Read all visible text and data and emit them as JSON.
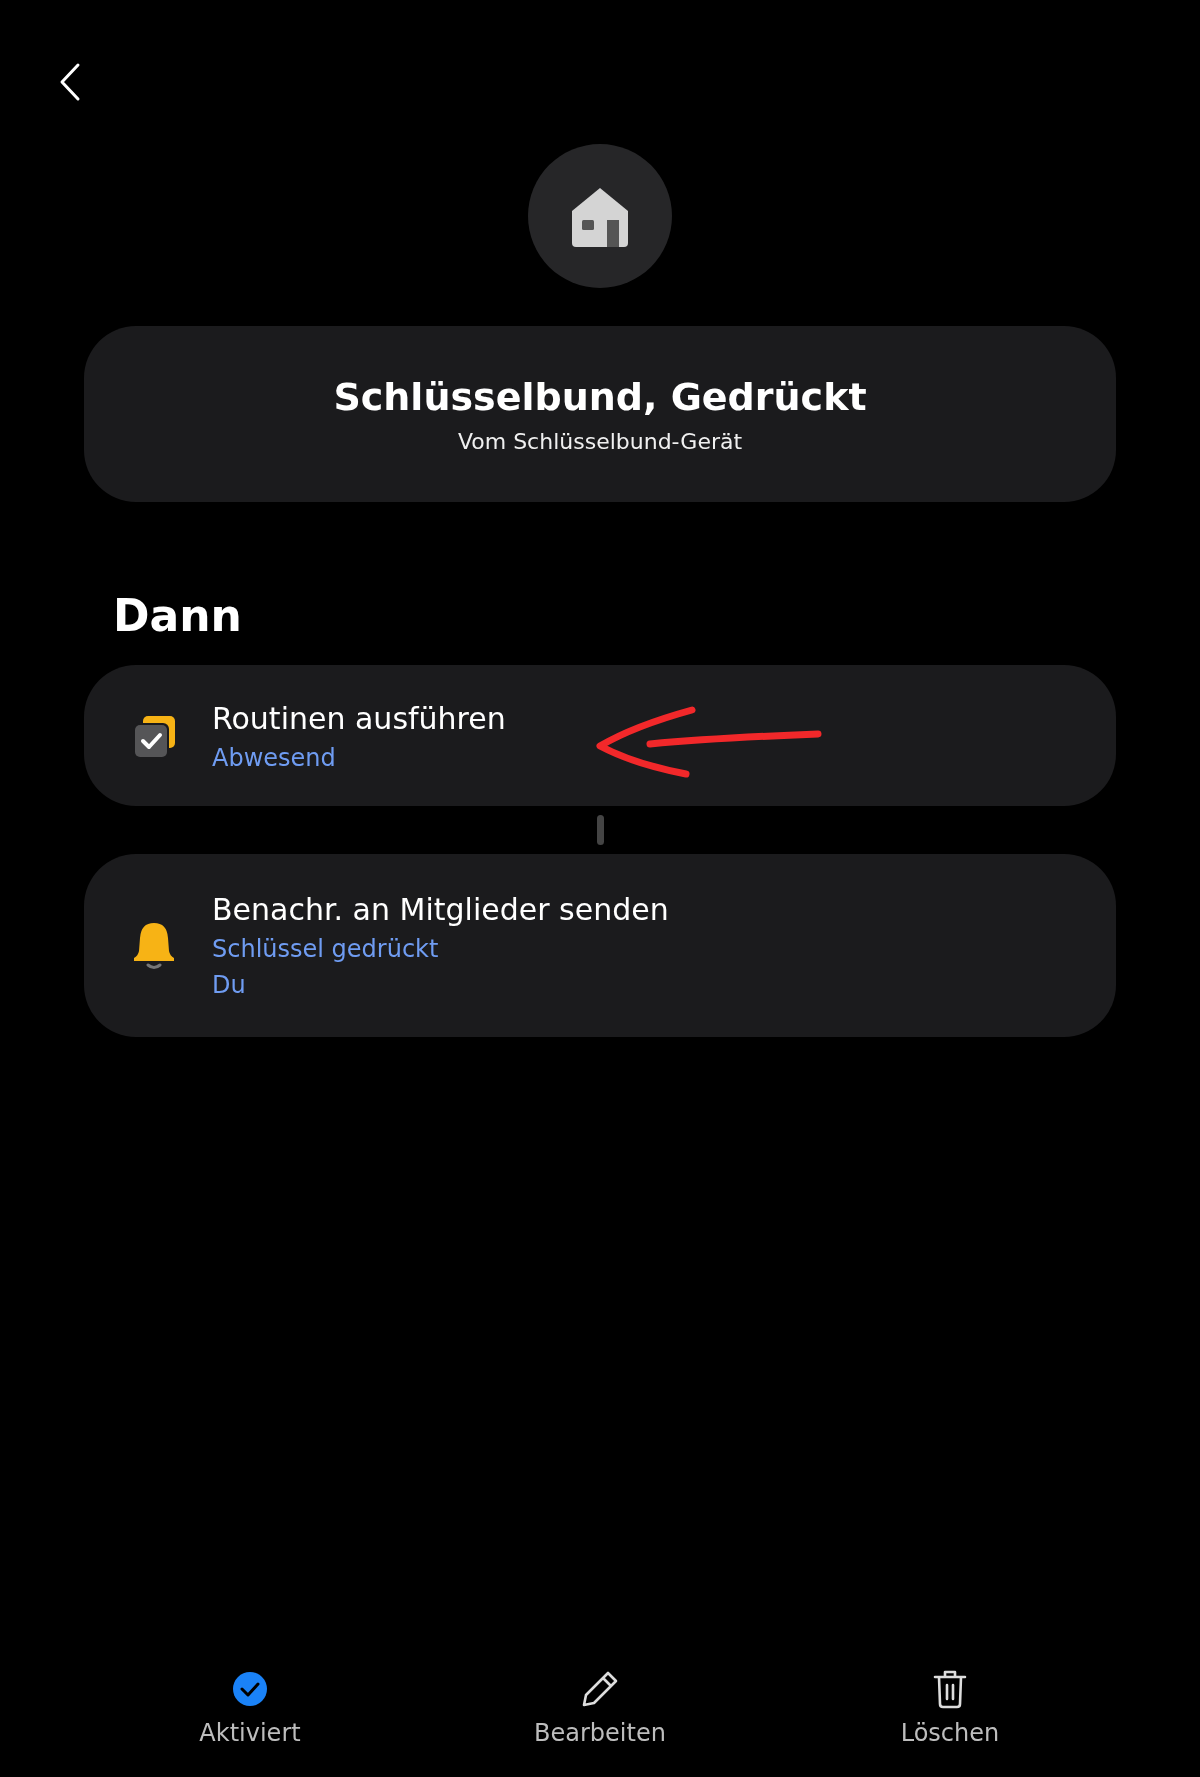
{
  "header": {
    "title": "Schlüsselbund, Gedrückt",
    "subtitle": "Vom Schlüsselbund-Gerät"
  },
  "section_title": "Dann",
  "actions": [
    {
      "kind": "routine",
      "title": "Routinen ausführen",
      "details": [
        "Abwesend"
      ]
    },
    {
      "kind": "notification",
      "title": "Benachr. an Mitglieder senden",
      "details": [
        "Schlüssel gedrückt",
        "Du"
      ]
    }
  ],
  "bottom_bar": [
    {
      "kind": "activated",
      "label": "Aktiviert",
      "on": true
    },
    {
      "kind": "edit",
      "label": "Bearbeiten"
    },
    {
      "kind": "delete",
      "label": "Löschen"
    }
  ]
}
